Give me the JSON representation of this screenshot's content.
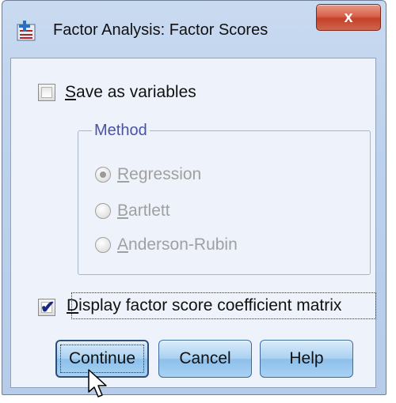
{
  "window": {
    "title": "Factor Analysis: Factor Scores",
    "close_label": "x",
    "accent": "#c9daf0"
  },
  "save_as_variables": {
    "label_prefix": "",
    "label_underlined": "S",
    "label_rest": "ave as variables",
    "checked": false
  },
  "method": {
    "legend": "Method",
    "options": [
      {
        "underlined": "R",
        "rest": "egression",
        "selected": true
      },
      {
        "underlined": "B",
        "rest": "artlett",
        "selected": false
      },
      {
        "underlined": "A",
        "rest": "nderson-Rubin",
        "selected": false
      }
    ],
    "disabled_color": "#a0a0a0"
  },
  "display_matrix": {
    "label_underlined": "D",
    "label_rest": "isplay factor score coefficient matrix",
    "checked": true
  },
  "buttons": {
    "continue": "Continue",
    "cancel": "Cancel",
    "help": "Help"
  }
}
